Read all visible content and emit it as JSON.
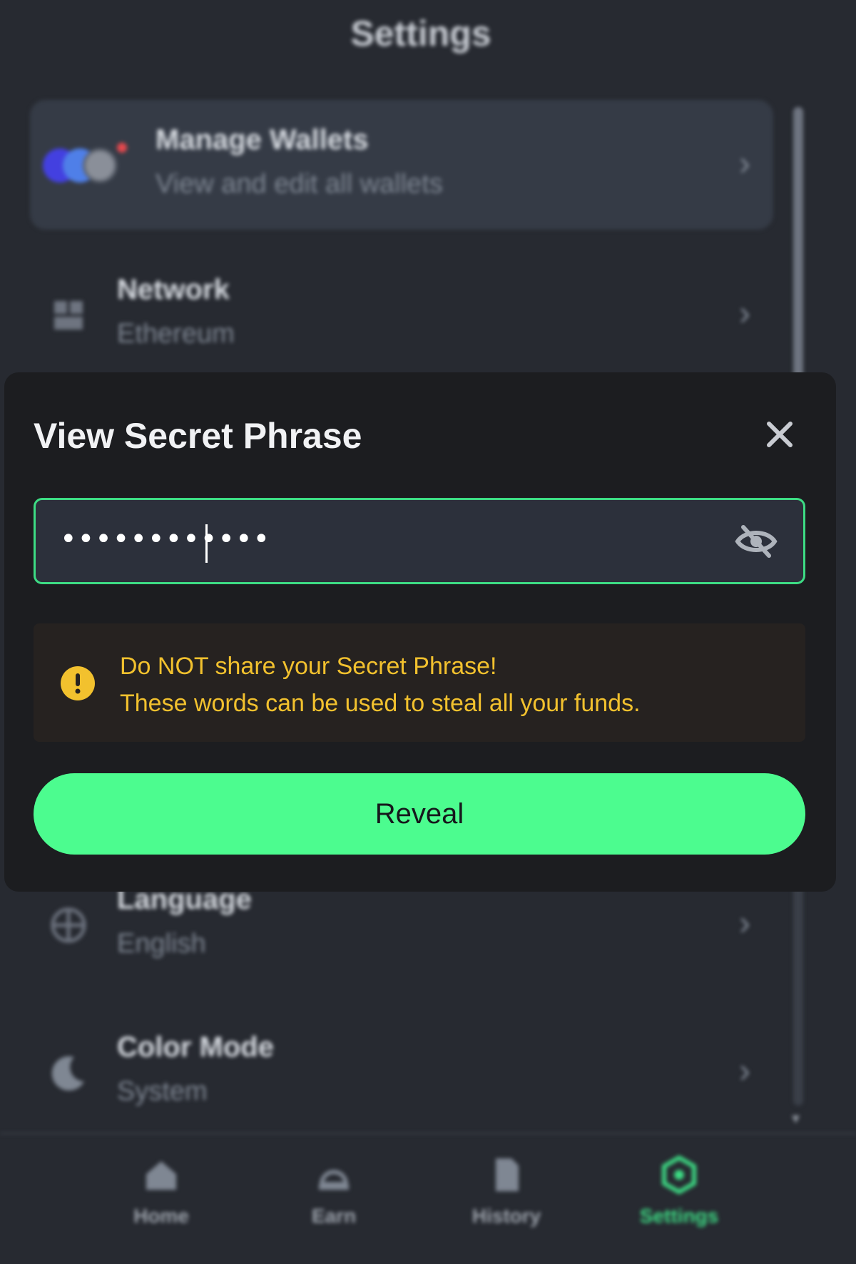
{
  "page": {
    "title": "Settings"
  },
  "settings": {
    "items": [
      {
        "label": "Manage Wallets",
        "value": "View and edit all wallets"
      },
      {
        "label": "Network",
        "value": "Ethereum"
      },
      {
        "label": "Language",
        "value": "English"
      },
      {
        "label": "Color Mode",
        "value": "System"
      }
    ]
  },
  "nav": {
    "items": [
      {
        "label": "Home",
        "icon": "home-icon"
      },
      {
        "label": "Earn",
        "icon": "earn-icon"
      },
      {
        "label": "History",
        "icon": "history-icon"
      },
      {
        "label": "Settings",
        "icon": "settings-icon",
        "active": true
      }
    ]
  },
  "modal": {
    "title": "View Secret Phrase",
    "password_value": "••••••••••••",
    "warning_line1": "Do NOT share your Secret Phrase!",
    "warning_line2": "These words can be used to steal all your funds.",
    "reveal_label": "Reveal"
  },
  "colors": {
    "accent": "#4cfc8f",
    "accent_border": "#3ddc84",
    "warning": "#f2c12e",
    "background": "#272a31",
    "modal": "#1c1d20"
  }
}
